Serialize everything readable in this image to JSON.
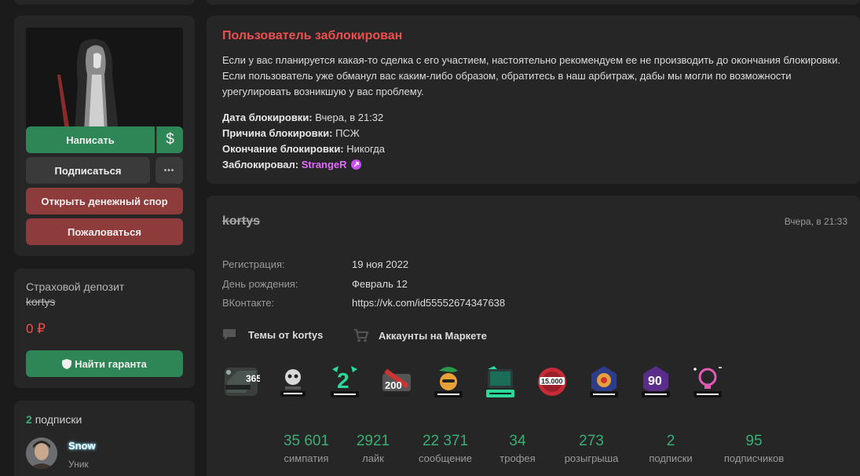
{
  "sidebar": {
    "buttons": {
      "write": "Написать",
      "money": "$",
      "subscribe": "Подписаться",
      "more": "•••",
      "dispute": "Открыть денежный спор",
      "report": "Пожаловаться"
    },
    "deposit": {
      "title": "Страховой депозит",
      "username": "kortys",
      "amount": "0 ₽",
      "guarantor_button": "Найти гаранта"
    },
    "subscriptions": {
      "count": "2",
      "label": "подписки",
      "user": {
        "name": "Snow",
        "role": "Уник"
      }
    }
  },
  "ban": {
    "title": "Пользователь заблокирован",
    "text": "Если у вас планируется какая-то сделка с его участием, настоятельно рекомендуем ее не производить до окончания блокировки. Если пользователь уже обманул вас каким-либо образом, обратитесь в наш арбитраж, дабы мы могли по возможности урегулировать возникшую у вас проблему.",
    "date_label": "Дата блокировки:",
    "date_value": "Вчера, в 21:32",
    "reason_label": "Причина блокировки:",
    "reason_value": "ПСЖ",
    "end_label": "Окончание блокировки:",
    "end_value": "Никогда",
    "by_label": "Заблокировал:",
    "by_value": "StrangeR"
  },
  "profile": {
    "username": "kortys",
    "last_seen": "Вчера, в 21:33",
    "info": [
      {
        "label": "Регистрация:",
        "value": "19 ноя 2022"
      },
      {
        "label": "День рождения:",
        "value": "Февраль 12"
      },
      {
        "label": "ВКонтакте:",
        "value": "https://vk.com/id55552674347638"
      }
    ],
    "links": {
      "threads": "Темы от kortys",
      "market": "Аккаунты на Маркете"
    },
    "badges": [
      "365 активный",
      "участник",
      "2 года на форуме",
      "200 розыгрышей",
      "летний активист",
      "организатор",
      "15.000 симпатий",
      "участник",
      "90 дней активный",
      "инноватор"
    ],
    "stats": [
      {
        "num": "35 601",
        "label": "симпатия"
      },
      {
        "num": "2921",
        "label": "лайк"
      },
      {
        "num": "22 371",
        "label": "сообщение"
      },
      {
        "num": "34",
        "label": "трофея"
      },
      {
        "num": "273",
        "label": "розыгрыша"
      },
      {
        "num": "2",
        "label": "подписки"
      },
      {
        "num": "95",
        "label": "подписчиков"
      }
    ]
  },
  "colors": {
    "accent_green": "#2e8556",
    "danger_red": "#ec4f4f",
    "moderator_purple": "#e36cff",
    "stat_green": "#3aae74"
  }
}
